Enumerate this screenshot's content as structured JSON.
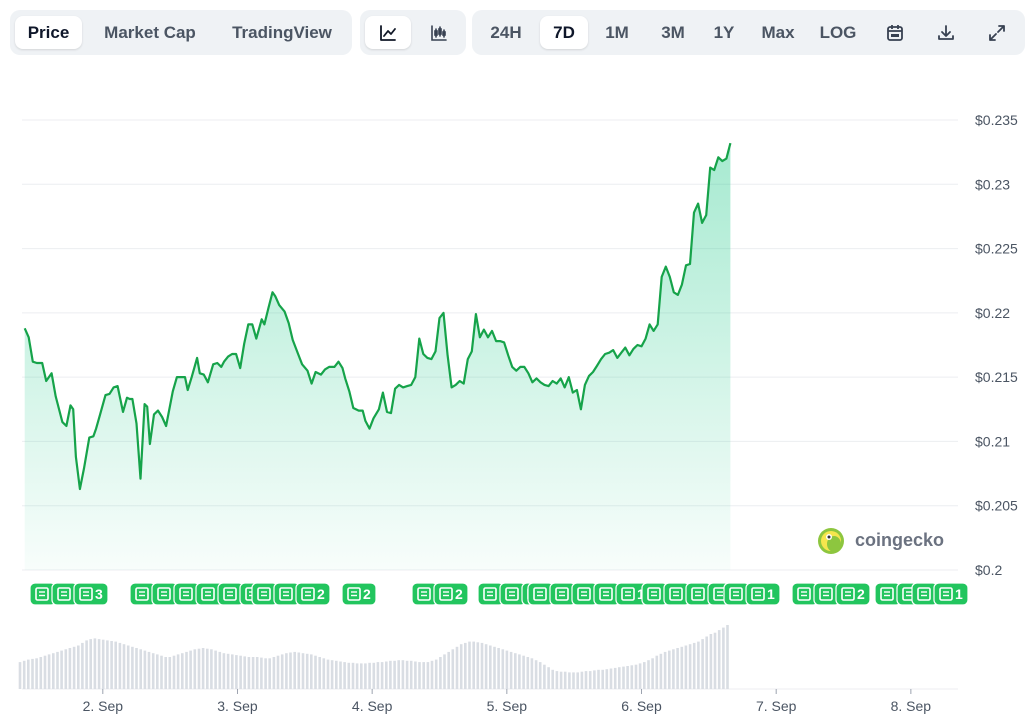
{
  "toolbar": {
    "view_tabs": [
      {
        "label": "Price",
        "active": true
      },
      {
        "label": "Market Cap",
        "active": false
      },
      {
        "label": "TradingView",
        "active": false
      }
    ],
    "chart_types": [
      {
        "icon": "line-chart-icon",
        "active": true
      },
      {
        "icon": "candlestick-chart-icon",
        "active": false
      }
    ],
    "ranges": [
      {
        "label": "24H",
        "active": false
      },
      {
        "label": "7D",
        "active": true
      },
      {
        "label": "1M",
        "active": false
      },
      {
        "label": "3M",
        "active": false
      },
      {
        "label": "1Y",
        "active": false
      },
      {
        "label": "Max",
        "active": false
      },
      {
        "label": "LOG",
        "active": false
      }
    ],
    "tools": [
      {
        "icon": "calendar-icon"
      },
      {
        "icon": "download-icon"
      },
      {
        "icon": "expand-icon"
      }
    ]
  },
  "watermark": {
    "text": "coingecko",
    "icon": "coingecko-logo-icon"
  },
  "colors": {
    "line": "#16a34a",
    "area_top": "#16c784",
    "news_badge": "#22c55e",
    "volume_bar": "#d9dde3",
    "grid": "#eceef1"
  },
  "news_badges": [
    {
      "group": 1,
      "count": "3"
    },
    {
      "group": 2,
      "count": "2"
    },
    {
      "group": 3,
      "count": "1"
    },
    {
      "group": 4,
      "count": "2"
    },
    {
      "group": 5,
      "count": "2"
    },
    {
      "group": 6,
      "count": "2"
    },
    {
      "group": 7,
      "count": "2"
    },
    {
      "group": 8,
      "count": "1"
    },
    {
      "group": 9,
      "count": "1"
    },
    {
      "group": 10,
      "count": "1"
    },
    {
      "group": 11,
      "count": "2"
    },
    {
      "group": 12,
      "count": "2"
    },
    {
      "group": 13,
      "count": "1"
    }
  ],
  "chart_data": {
    "type": "area",
    "ylim": [
      0.2,
      0.235
    ],
    "yticks": [
      "$0.235",
      "$0.23",
      "$0.225",
      "$0.22",
      "$0.215",
      "$0.21",
      "$0.205",
      "$0.2"
    ],
    "ytick_values": [
      0.235,
      0.23,
      0.225,
      0.22,
      0.215,
      0.21,
      0.205,
      0.2
    ],
    "xticks": [
      "2. Sep",
      "3. Sep",
      "4. Sep",
      "5. Sep",
      "6. Sep",
      "7. Sep",
      "8. Sep"
    ],
    "xtick_positions": [
      1,
      2,
      3,
      4,
      5,
      6,
      7
    ],
    "xlim": [
      0.4,
      7.35
    ],
    "x": [
      0.42,
      0.45,
      0.48,
      0.51,
      0.55,
      0.58,
      0.62,
      0.65,
      0.7,
      0.73,
      0.76,
      0.78,
      0.8,
      0.83,
      0.86,
      0.9,
      0.93,
      0.95,
      0.98,
      1.02,
      1.05,
      1.08,
      1.11,
      1.15,
      1.18,
      1.2,
      1.22,
      1.25,
      1.28,
      1.31,
      1.33,
      1.35,
      1.38,
      1.41,
      1.44,
      1.47,
      1.52,
      1.55,
      1.58,
      1.61,
      1.63,
      1.66,
      1.7,
      1.72,
      1.75,
      1.78,
      1.82,
      1.85,
      1.88,
      1.9,
      1.93,
      1.96,
      1.99,
      2.02,
      2.05,
      2.08,
      2.11,
      2.14,
      2.18,
      2.2,
      2.23,
      2.26,
      2.28,
      2.31,
      2.35,
      2.38,
      2.41,
      2.45,
      2.48,
      2.52,
      2.55,
      2.58,
      2.62,
      2.65,
      2.68,
      2.72,
      2.75,
      2.78,
      2.8,
      2.83,
      2.86,
      2.9,
      2.93,
      2.95,
      2.98,
      3.01,
      3.05,
      3.08,
      3.11,
      3.14,
      3.17,
      3.2,
      3.23,
      3.26,
      3.29,
      3.32,
      3.35,
      3.38,
      3.41,
      3.44,
      3.47,
      3.5,
      3.53,
      3.56,
      3.59,
      3.62,
      3.65,
      3.68,
      3.71,
      3.74,
      3.77,
      3.8,
      3.83,
      3.86,
      3.89,
      3.92,
      3.95,
      3.98,
      4.01,
      4.04,
      4.07,
      4.1,
      4.13,
      4.16,
      4.19,
      4.22,
      4.25,
      4.28,
      4.31,
      4.34,
      4.37,
      4.4,
      4.43,
      4.46,
      4.49,
      4.52,
      4.55,
      4.58,
      4.61,
      4.64,
      4.67,
      4.7,
      4.73,
      4.76,
      4.79,
      4.82,
      4.85,
      4.88,
      4.91,
      4.94,
      4.97,
      5.0,
      5.03,
      5.06,
      5.09,
      5.12,
      5.15,
      5.18,
      5.21,
      5.24,
      5.27,
      5.3,
      5.33,
      5.36,
      5.39,
      5.42,
      5.45,
      5.48,
      5.51,
      5.54,
      5.57,
      5.6,
      5.63,
      5.66,
      5.69,
      5.72,
      5.75,
      5.78,
      5.81,
      5.84,
      5.87,
      5.9,
      5.93,
      5.96,
      5.99,
      6.02,
      6.05,
      6.08,
      6.11,
      6.14,
      6.17,
      6.2,
      6.23,
      6.26,
      6.29,
      6.32,
      6.35,
      6.38,
      6.41,
      6.44,
      6.47,
      6.5,
      6.53,
      6.56,
      6.59,
      6.62,
      6.65,
      6.68,
      6.71,
      6.74,
      6.77,
      6.8,
      6.83,
      6.86,
      6.89,
      6.92,
      6.95,
      6.98,
      7.01,
      7.04,
      7.07,
      7.1,
      7.13,
      7.16,
      7.19,
      7.22,
      7.25,
      7.28,
      7.31,
      7.33
    ],
    "series": [
      {
        "values": [
          0.2188,
          0.2181,
          0.2162,
          0.2161,
          0.2161,
          0.2147,
          0.2153,
          0.2135,
          0.2115,
          0.2112,
          0.2128,
          0.2125,
          0.2088,
          0.2063,
          0.2079,
          0.2103,
          0.2104,
          0.211,
          0.2121,
          0.2136,
          0.2137,
          0.2142,
          0.2143,
          0.2123,
          0.2134,
          0.2133,
          0.2133,
          0.2114,
          0.2071,
          0.2129,
          0.2127,
          0.2098,
          0.2121,
          0.2124,
          0.2119,
          0.2112,
          0.2139,
          0.215,
          0.215,
          0.215,
          0.214,
          0.215,
          0.2165,
          0.2153,
          0.2152,
          0.2146,
          0.216,
          0.2161,
          0.2158,
          0.2162,
          0.2166,
          0.2168,
          0.2168,
          0.2157,
          0.2176,
          0.2191,
          0.2191,
          0.218,
          0.2195,
          0.2191,
          0.2204,
          0.2216,
          0.2213,
          0.2206,
          0.2201,
          0.2192,
          0.2179,
          0.2168,
          0.216,
          0.2155,
          0.2145,
          0.2154,
          0.2152,
          0.2156,
          0.2158,
          0.2158,
          0.2162,
          0.2157,
          0.2149,
          0.2139,
          0.2126,
          0.2124,
          0.2124,
          0.2116,
          0.211,
          0.2118,
          0.2125,
          0.2138,
          0.2123,
          0.2122,
          0.2141,
          0.2144,
          0.2142,
          0.2143,
          0.2144,
          0.215,
          0.218,
          0.2168,
          0.2165,
          0.2164,
          0.217,
          0.2196,
          0.22,
          0.2167,
          0.2142,
          0.2144,
          0.2147,
          0.2145,
          0.2164,
          0.217,
          0.2199,
          0.2181,
          0.2187,
          0.2181,
          0.2186,
          0.2178,
          0.2178,
          0.2177,
          0.2167,
          0.2158,
          0.2155,
          0.2158,
          0.2158,
          0.2153,
          0.2146,
          0.2149,
          0.2146,
          0.2144,
          0.2143,
          0.2147,
          0.2145,
          0.2149,
          0.2142,
          0.215,
          0.2138,
          0.214,
          0.2125,
          0.2144,
          0.2151,
          0.2154,
          0.2159,
          0.2164,
          0.2168,
          0.2169,
          0.2171,
          0.2165,
          0.2169,
          0.2173,
          0.2167,
          0.2172,
          0.2175,
          0.2174,
          0.218,
          0.2191,
          0.2186,
          0.2191,
          0.2228,
          0.2236,
          0.2228,
          0.2216,
          0.2214,
          0.2222,
          0.2237,
          0.2238,
          0.2278,
          0.2285,
          0.227,
          0.2276,
          0.2313,
          0.2311,
          0.2321,
          0.2318,
          0.232,
          0.2332
        ]
      }
    ],
    "volume": [
      0.42,
      0.44,
      0.46,
      0.47,
      0.48,
      0.5,
      0.52,
      0.54,
      0.56,
      0.58,
      0.6,
      0.62,
      0.64,
      0.66,
      0.68,
      0.72,
      0.76,
      0.78,
      0.79,
      0.78,
      0.77,
      0.76,
      0.75,
      0.74,
      0.72,
      0.7,
      0.68,
      0.66,
      0.64,
      0.62,
      0.6,
      0.58,
      0.56,
      0.54,
      0.52,
      0.5,
      0.5,
      0.52,
      0.54,
      0.56,
      0.58,
      0.6,
      0.62,
      0.63,
      0.64,
      0.63,
      0.62,
      0.6,
      0.58,
      0.56,
      0.55,
      0.54,
      0.53,
      0.52,
      0.51,
      0.5,
      0.5,
      0.5,
      0.49,
      0.48,
      0.48,
      0.5,
      0.52,
      0.54,
      0.56,
      0.57,
      0.58,
      0.57,
      0.56,
      0.55,
      0.54,
      0.52,
      0.5,
      0.48,
      0.46,
      0.45,
      0.44,
      0.43,
      0.42,
      0.41,
      0.41,
      0.4,
      0.4,
      0.4,
      0.41,
      0.41,
      0.42,
      0.42,
      0.43,
      0.44,
      0.44,
      0.45,
      0.45,
      0.44,
      0.44,
      0.43,
      0.42,
      0.42,
      0.42,
      0.44,
      0.46,
      0.5,
      0.54,
      0.58,
      0.62,
      0.66,
      0.7,
      0.72,
      0.74,
      0.74,
      0.73,
      0.72,
      0.7,
      0.68,
      0.66,
      0.64,
      0.62,
      0.6,
      0.58,
      0.56,
      0.54,
      0.52,
      0.5,
      0.48,
      0.45,
      0.42,
      0.38,
      0.34,
      0.3,
      0.28,
      0.27,
      0.27,
      0.26,
      0.26,
      0.26,
      0.27,
      0.28,
      0.28,
      0.29,
      0.3,
      0.3,
      0.31,
      0.32,
      0.33,
      0.34,
      0.35,
      0.36,
      0.37,
      0.38,
      0.4,
      0.42,
      0.45,
      0.48,
      0.52,
      0.55,
      0.58,
      0.6,
      0.62,
      0.64,
      0.66,
      0.68,
      0.7,
      0.72,
      0.74,
      0.78,
      0.82,
      0.86,
      0.88,
      0.92,
      0.96,
      1.0
    ]
  }
}
